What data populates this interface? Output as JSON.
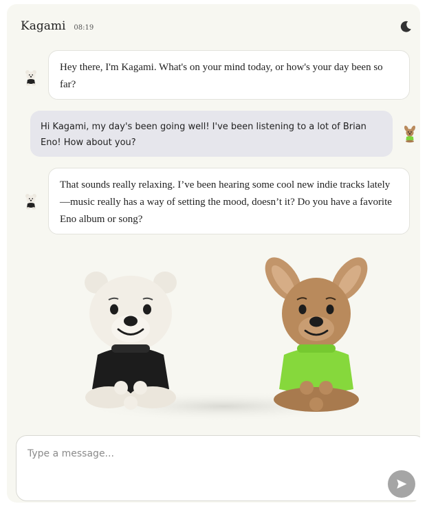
{
  "header": {
    "title": "Kagami",
    "time": "08:19",
    "theme_icon": "moon-icon"
  },
  "messages": [
    {
      "role": "assistant",
      "avatar": "bear-avatar",
      "text": "Hey there, I'm Kagami. What's on your mind today, or how's your day been so far?"
    },
    {
      "role": "user",
      "avatar": "kangaroo-avatar",
      "text": "Hi Kagami, my day's been going well! I've been listening to a lot of Brian Eno! How about you?"
    },
    {
      "role": "assistant",
      "avatar": "bear-avatar",
      "text": "That sounds really relaxing. I’ve been hearing some cool new indie tracks lately—music really has a way of setting the mood, doesn’t it? Do you have a favorite Eno album or song?"
    }
  ],
  "composer": {
    "placeholder": "Type a message...",
    "value": "",
    "send_icon": "send-icon"
  },
  "colors": {
    "panel": "#f7f7f1",
    "user_bubble": "#e6e6ec",
    "send_button": "#a5a5a5"
  }
}
